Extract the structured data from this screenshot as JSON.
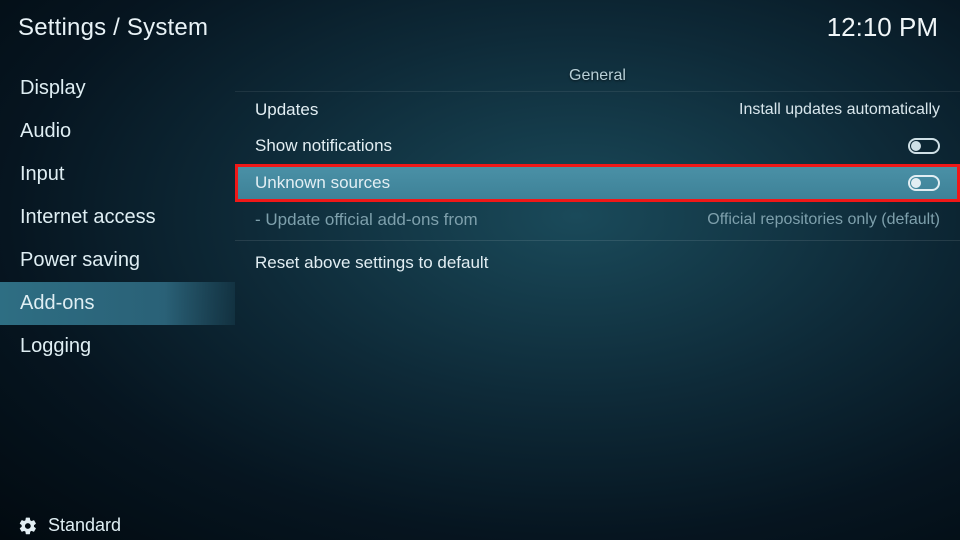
{
  "header": {
    "breadcrumb": "Settings / System",
    "clock": "12:10 PM"
  },
  "sidebar": {
    "items": [
      {
        "label": "Display"
      },
      {
        "label": "Audio"
      },
      {
        "label": "Input"
      },
      {
        "label": "Internet access"
      },
      {
        "label": "Power saving"
      },
      {
        "label": "Add-ons"
      },
      {
        "label": "Logging"
      }
    ],
    "selected_index": 5
  },
  "footer": {
    "level_label": "Standard"
  },
  "main": {
    "section_title": "General",
    "rows": [
      {
        "label": "Updates",
        "value": "Install updates automatically",
        "type": "value"
      },
      {
        "label": "Show notifications",
        "type": "toggle",
        "on": false
      },
      {
        "label": "Unknown sources",
        "type": "toggle",
        "on": false,
        "highlighted": true
      },
      {
        "label": "- Update official add-ons from",
        "value": "Official repositories only (default)",
        "type": "value",
        "dim": true
      },
      {
        "label": "Reset above settings to default",
        "type": "action",
        "reset": true
      }
    ]
  }
}
